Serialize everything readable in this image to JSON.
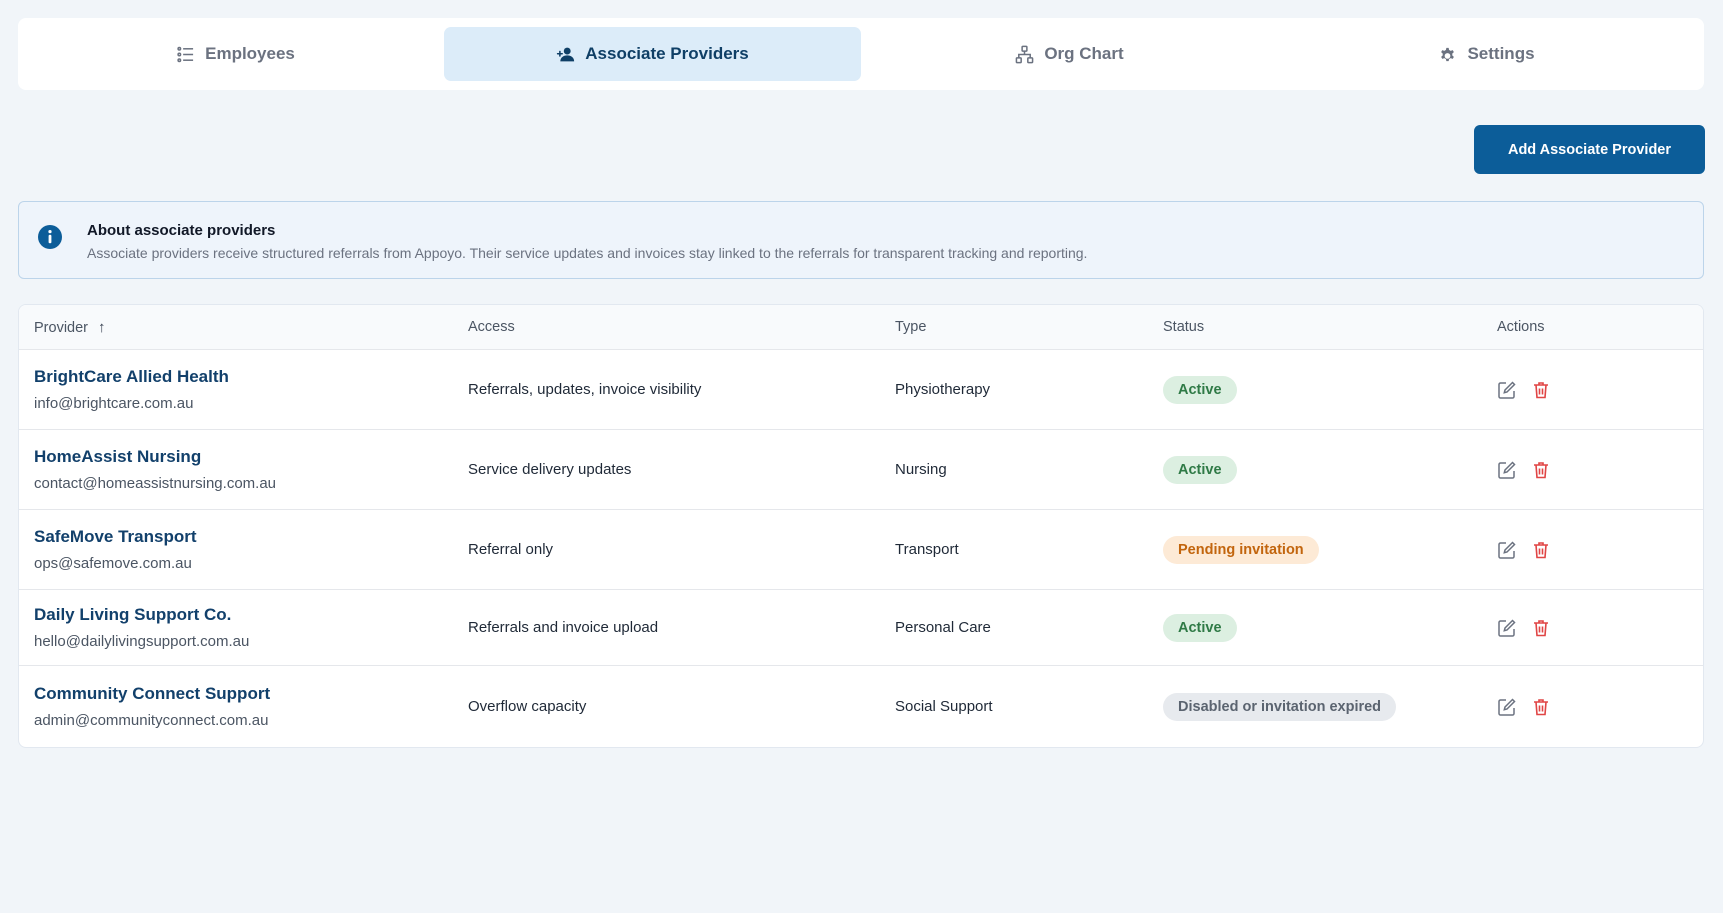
{
  "tabs": [
    {
      "label": "Employees",
      "icon": "list-icon",
      "active": false
    },
    {
      "label": "Associate Providers",
      "icon": "user-plus-icon",
      "active": true
    },
    {
      "label": "Org Chart",
      "icon": "org-chart-icon",
      "active": false
    },
    {
      "label": "Settings",
      "icon": "gear-icon",
      "active": false
    }
  ],
  "add_button_label": "Add Associate Provider",
  "info": {
    "title": "About associate providers",
    "body": "Associate providers receive structured referrals from Appoyo. Their service updates and invoices stay linked to the referrals for transparent tracking and reporting."
  },
  "table": {
    "headers": {
      "provider": "Provider",
      "access": "Access",
      "type": "Type",
      "status": "Status",
      "actions": "Actions"
    },
    "sort_indicator": "↑",
    "rows": [
      {
        "name": "BrightCare Allied Health",
        "email": "info@brightcare.com.au",
        "access": "Referrals, updates, invoice visibility",
        "type": "Physiotherapy",
        "status": "Active"
      },
      {
        "name": "HomeAssist Nursing",
        "email": "contact@homeassistnursing.com.au",
        "access": "Service delivery updates",
        "type": "Nursing",
        "status": "Active"
      },
      {
        "name": "SafeMove Transport",
        "email": "ops@safemove.com.au",
        "access": "Referral only",
        "type": "Transport",
        "status": "Pending invitation"
      },
      {
        "name": "Daily Living Support Co.",
        "email": "hello@dailylivingsupport.com.au",
        "access": "Referrals and invoice upload",
        "type": "Personal Care",
        "status": "Active"
      },
      {
        "name": "Community Connect Support",
        "email": "admin@communityconnect.com.au",
        "access": "Overflow capacity",
        "type": "Social Support",
        "status": "Disabled or invitation expired"
      }
    ]
  },
  "colors": {
    "primary": "#0c5d99",
    "active_badge": "#2f7a46",
    "pending_badge": "#c2650d",
    "disabled_badge": "#5b6470",
    "delete_icon": "#e04545"
  }
}
